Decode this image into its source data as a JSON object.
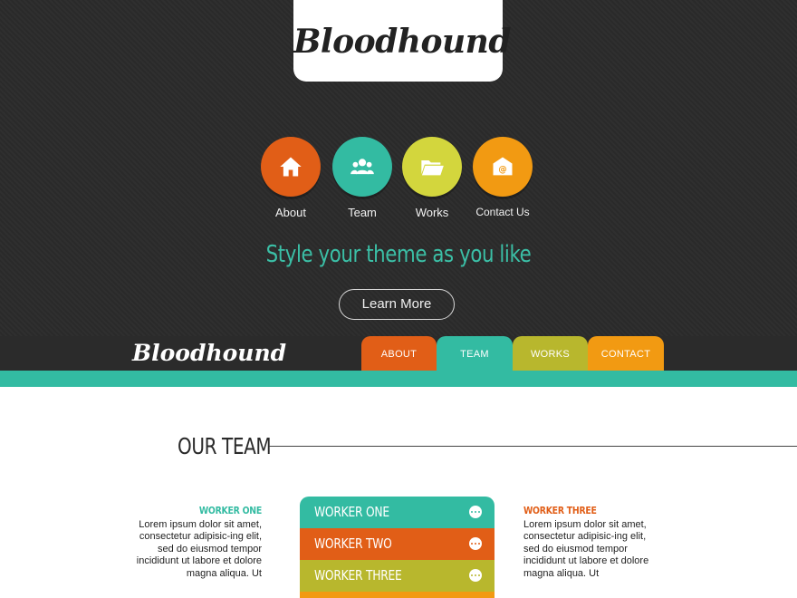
{
  "hero": {
    "logo": "Bloodhound",
    "circles": [
      {
        "label": "About",
        "icon": "home-icon",
        "color": "#e15e17"
      },
      {
        "label": "Team",
        "icon": "team-icon",
        "color": "#33bba2"
      },
      {
        "label": "Works",
        "icon": "folder-icon",
        "color": "#d3d63d"
      },
      {
        "label": "Contact Us",
        "icon": "mail-icon",
        "color": "#f29a12"
      }
    ],
    "tagline": "Style your theme as you like",
    "button": "Learn More"
  },
  "navbar": {
    "logo": "Bloodhound",
    "tabs": [
      {
        "label": "ABOUT",
        "color": "#e15e17"
      },
      {
        "label": "TEAM",
        "color": "#33bba2"
      },
      {
        "label": "WORKS",
        "color": "#b8b72d"
      },
      {
        "label": "CONTACT",
        "color": "#f29a12"
      }
    ]
  },
  "team": {
    "title": "OUR TEAM",
    "left_worker": {
      "name": "WORKER ONE",
      "text": "Lorem ipsum dolor sit amet, consectetur adipisic-ing elit, sed do eiusmod tempor incididunt ut labore et dolore magna aliqua. Ut"
    },
    "right_worker": {
      "name": "WORKER THREE",
      "text": "Lorem ipsum dolor sit amet, consectetur adipisic-ing elit, sed do eiusmod tempor incididunt ut labore et dolore magna aliqua. Ut"
    },
    "accordion": [
      {
        "label": "WORKER ONE",
        "color": "#33bba2"
      },
      {
        "label": "WORKER TWO",
        "color": "#e15e17"
      },
      {
        "label": "WORKER THREE",
        "color": "#b8b72d"
      }
    ]
  }
}
